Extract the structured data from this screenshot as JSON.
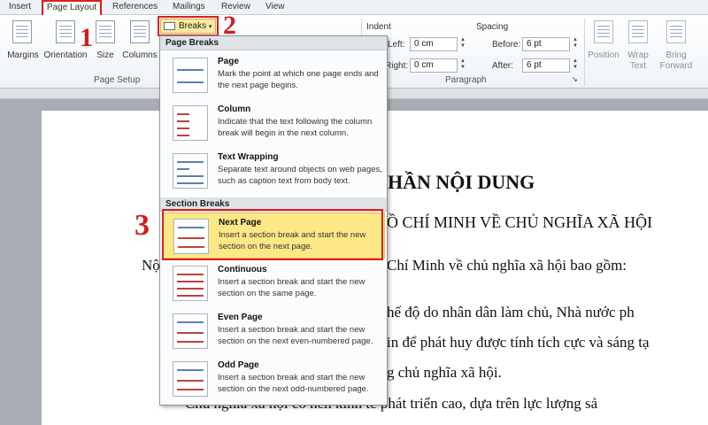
{
  "tabs": [
    "Insert",
    "Page Layout",
    "References",
    "Mailings",
    "Review",
    "View"
  ],
  "ribbon": {
    "buttons": [
      "Margins",
      "Orientation",
      "Size",
      "Columns"
    ],
    "breaks_label": "Breaks",
    "page_setup_label": "Page Setup",
    "indent_label": "Indent",
    "indent_left_label": "Left:",
    "indent_left_value": "0 cm",
    "indent_right_label": "Right:",
    "indent_right_value": "0 cm",
    "spacing_label": "Spacing",
    "before_label": "Before:",
    "before_value": "6 pt",
    "after_label": "After:",
    "after_value": "6 pt",
    "paragraph_label": "Paragraph",
    "arrange_buttons": [
      "Position",
      "Wrap Text",
      "Bring Forward"
    ]
  },
  "dropdown": {
    "page_breaks_header": "Page Breaks",
    "section_breaks_header": "Section Breaks",
    "items": [
      {
        "title": "Page",
        "desc": "Mark the point at which one page ends and the next page begins."
      },
      {
        "title": "Column",
        "desc": "Indicate that the text following the column break will begin in the next column."
      },
      {
        "title": "Text Wrapping",
        "desc": "Separate text around objects on web pages, such as caption text from body text."
      },
      {
        "title": "Next Page",
        "desc": "Insert a section break and start the new section on the next page."
      },
      {
        "title": "Continuous",
        "desc": "Insert a section break and start the new section on the same page."
      },
      {
        "title": "Even Page",
        "desc": "Insert a section break and start the new section on the next even-numbered page."
      },
      {
        "title": "Odd Page",
        "desc": "Insert a section break and start the new section on the next odd-numbered page."
      }
    ]
  },
  "document": {
    "heading1": "HẦN NỘI DUNG",
    "heading2": "Ồ CHÍ MINH VỀ CHỦ NGHĨA XÃ HỘI",
    "line1_left": "Nộ",
    "line1_right": "Chí Minh về chủ nghĩa xã hội bao gồm:",
    "line2": "hế độ do nhân dân làm chủ, Nhà nước ph",
    "line3": "in để phát huy được tính tích cực và sáng tạ",
    "line4": "g chủ nghĩa xã hội.",
    "line5": "Chủ nghĩa xã hội có nền kinh tế phát triển cao, dựa trên lực lượng sả"
  },
  "callouts": [
    "1",
    "2",
    "3"
  ]
}
